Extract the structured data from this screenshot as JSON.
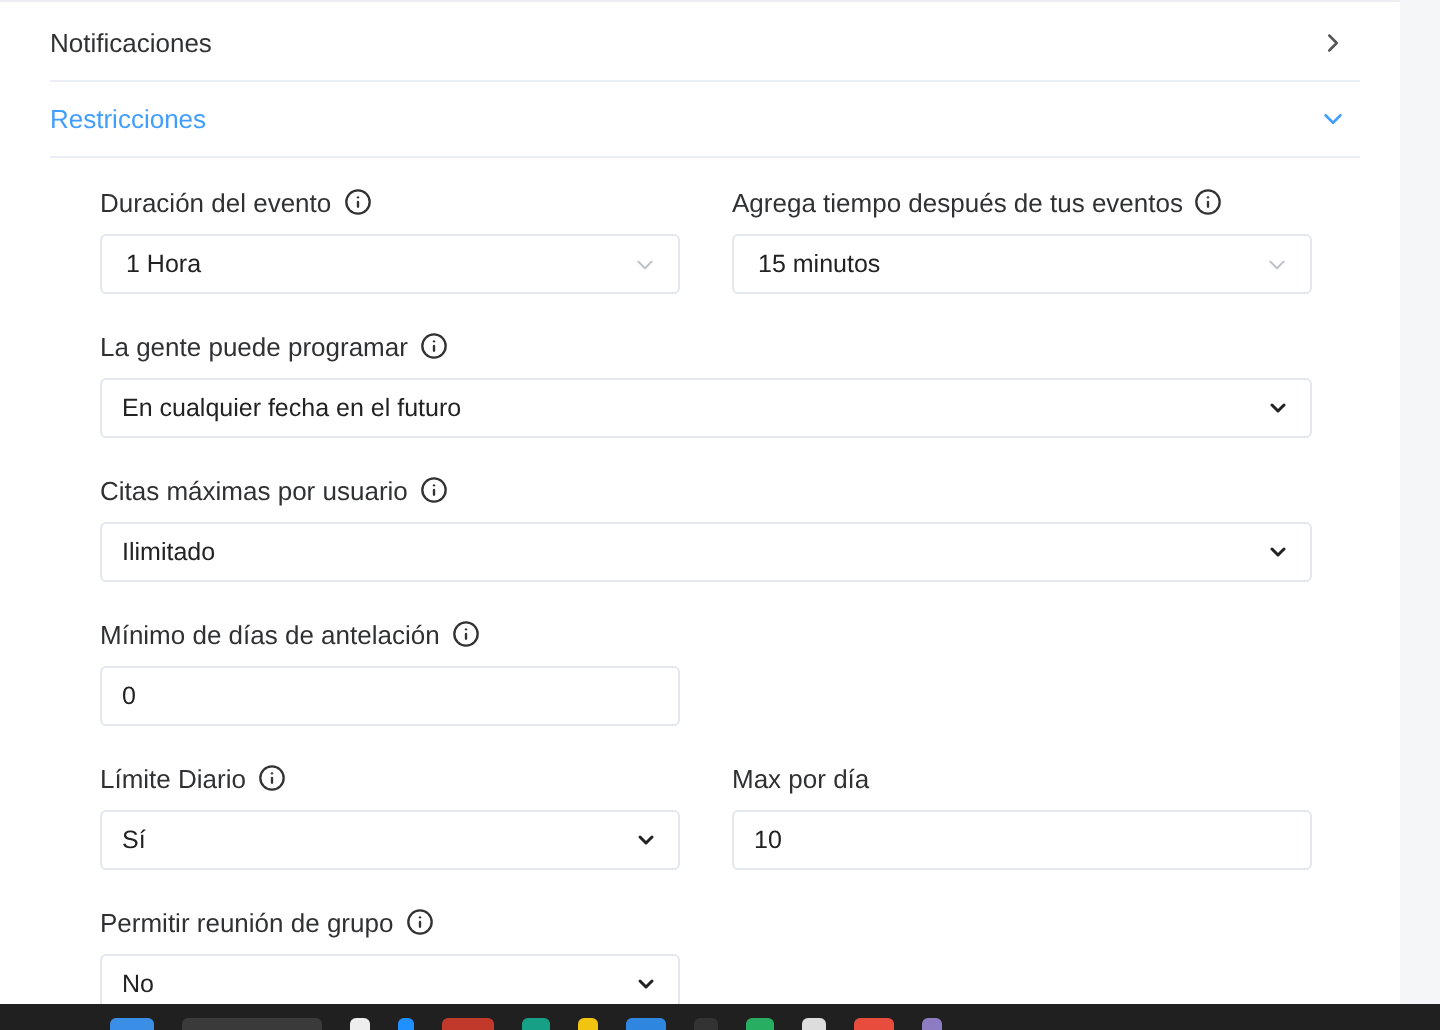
{
  "sections": [
    {
      "title": "Notificaciones",
      "expanded": false
    },
    {
      "title": "Restricciones",
      "expanded": true,
      "rows": [
        [
          {
            "label": "Duración del evento",
            "info": true,
            "kind": "select",
            "value": "1 Hora"
          },
          {
            "label": "Agrega tiempo después de tus eventos",
            "info": true,
            "kind": "select",
            "value": "15 minutos"
          }
        ],
        [
          {
            "label": "La gente puede programar",
            "info": true,
            "kind": "native-select",
            "value": "En cualquier fecha en el futuro",
            "wide": true
          }
        ],
        [
          {
            "label": "Citas máximas por usuario",
            "info": true,
            "kind": "native-select",
            "value": "Ilimitado",
            "wide": true
          }
        ],
        [
          {
            "label": "Mínimo de días de antelación",
            "info": true,
            "kind": "input",
            "value": "0"
          }
        ],
        [
          {
            "label": "Límite Diario",
            "info": true,
            "kind": "native-select",
            "value": "Sí"
          },
          {
            "label": "Max por día",
            "info": false,
            "kind": "input",
            "value": "10"
          }
        ],
        [
          {
            "label": "Permitir reunión de grupo",
            "info": true,
            "kind": "native-select",
            "value": "No"
          }
        ]
      ]
    }
  ]
}
